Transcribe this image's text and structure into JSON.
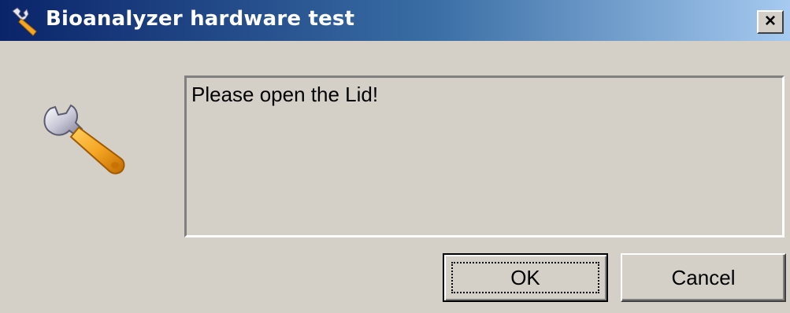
{
  "window": {
    "title": "Bioanalyzer hardware test",
    "title_icon": "wrench-icon",
    "close_label": "×"
  },
  "dialog": {
    "icon": "wrench-icon",
    "message": "Please open the Lid!"
  },
  "buttons": {
    "ok_label": "OK",
    "cancel_label": "Cancel"
  },
  "colors": {
    "titlebar_start": "#0a246a",
    "titlebar_end": "#a6caf0",
    "dialog_face": "#d4d0c8",
    "wrench_handle": "#f5a623"
  }
}
